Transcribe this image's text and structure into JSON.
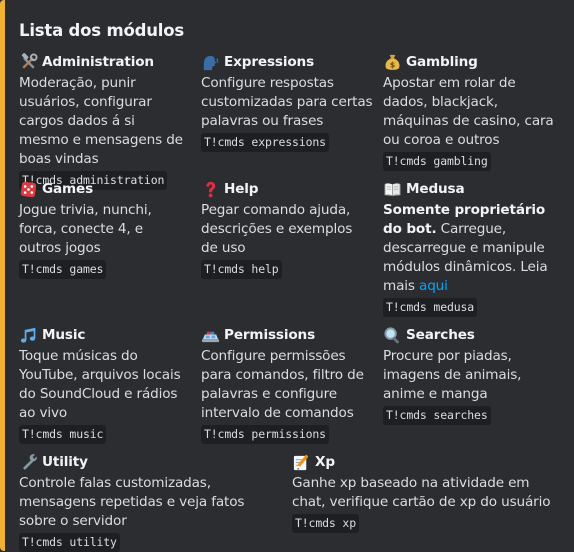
{
  "embed": {
    "title": "Lista dos módulos",
    "accent_color": "#f0b232"
  },
  "modules": {
    "administration": {
      "icon": "hammer-wrench-icon",
      "name": "Administration",
      "description": "Moderação, punir usuários, configurar cargos dados á si mesmo e mensagens de boas vindas",
      "command": "T!cmds administration"
    },
    "expressions": {
      "icon": "speaking-head-icon",
      "name": "Expressions",
      "description": "Configure respostas customizadas para certas palavras ou frases",
      "command": "T!cmds expressions"
    },
    "gambling": {
      "icon": "money-bag-icon",
      "name": "Gambling",
      "description": "Apostar em rolar de dados, blackjack, máquinas de casino, cara ou coroa e outros",
      "command": "T!cmds gambling"
    },
    "games": {
      "icon": "game-die-icon",
      "name": "Games",
      "description": "Jogue trivia, nunchi, forca, conecte 4, e outros jogos",
      "command": "T!cmds games"
    },
    "help": {
      "icon": "question-mark-icon",
      "name": "Help",
      "description": "Pegar comando ajuda, descrições e exemplos de uso",
      "command": "T!cmds help"
    },
    "medusa": {
      "icon": "open-book-icon",
      "name": "Medusa",
      "bold_text": "Somente proprietário do bot.",
      "description": " Carregue, descarregue e manipule módulos dinâmicos. Leia mais ",
      "link_text": "aqui",
      "command": "T!cmds medusa"
    },
    "music": {
      "icon": "musical-notes-icon",
      "name": "Music",
      "description": "Toque músicas do YouTube, arquivos locais do SoundCloud e rádios ao vivo",
      "command": "T!cmds music"
    },
    "permissions": {
      "icon": "police-light-icon",
      "name": "Permissions",
      "description": "Configure permissões para comandos, filtro de palavras e configure intervalo de comandos",
      "command": "T!cmds permissions"
    },
    "searches": {
      "icon": "magnifying-glass-icon",
      "name": "Searches",
      "description": "Procure por piadas, imagens de animais, anime e manga",
      "command": "T!cmds searches"
    },
    "utility": {
      "icon": "wrench-icon",
      "name": "Utility",
      "description": "Controle falas customizadas, mensagens repetidas e veja fatos sobre o servidor",
      "command": "T!cmds utility"
    },
    "xp": {
      "icon": "memo-icon",
      "name": "Xp",
      "description": "Ganhe xp baseado na atividade em chat, verifique cartão de xp do usuário",
      "command": "T!cmds xp"
    }
  }
}
